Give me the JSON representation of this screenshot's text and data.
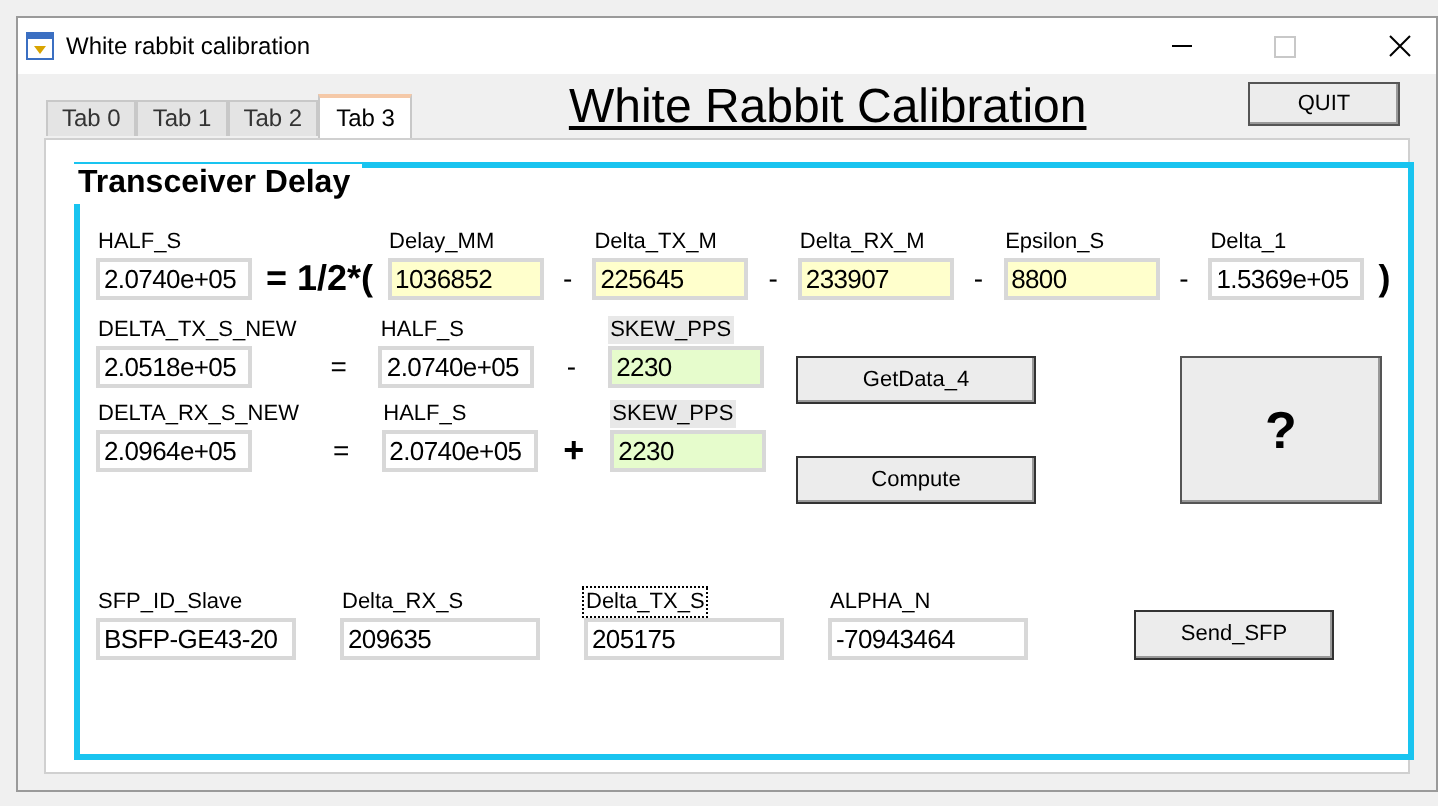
{
  "window": {
    "title": "White rabbit calibration"
  },
  "tabs": [
    {
      "label": "Tab 0",
      "selected": false
    },
    {
      "label": "Tab 1",
      "selected": false
    },
    {
      "label": "Tab 2",
      "selected": false
    },
    {
      "label": "Tab 3",
      "selected": true
    }
  ],
  "heading": "White Rabbit Calibration",
  "quit_button": "QUIT",
  "group": {
    "title": "Transceiver Delay",
    "formula_row": [
      {
        "kind": "field",
        "label": "HALF_S",
        "value": "2.0740e+05",
        "color": "#ffffff"
      },
      {
        "kind": "operator",
        "text": "= 1/2*(",
        "emphasis": true
      },
      {
        "kind": "field",
        "label": "Delay_MM",
        "value": "1036852",
        "color": "#ffffcc"
      },
      {
        "kind": "operator",
        "text": "-",
        "emphasis": false
      },
      {
        "kind": "field",
        "label": "Delta_TX_M",
        "value": "225645",
        "color": "#ffffcc"
      },
      {
        "kind": "operator",
        "text": "-",
        "emphasis": false
      },
      {
        "kind": "field",
        "label": "Delta_RX_M",
        "value": "233907",
        "color": "#ffffcc"
      },
      {
        "kind": "operator",
        "text": "-",
        "emphasis": false
      },
      {
        "kind": "field",
        "label": "Epsilon_S",
        "value": "8800",
        "color": "#ffffcc"
      },
      {
        "kind": "operator",
        "text": "-",
        "emphasis": false
      },
      {
        "kind": "field",
        "label": "Delta_1",
        "value": "1.5369e+05",
        "color": "#ffffff"
      },
      {
        "kind": "operator",
        "text": ")",
        "emphasis": true
      }
    ],
    "equation_rows": [
      [
        {
          "kind": "field",
          "label": "DELTA_TX_S_NEW",
          "value": "2.0518e+05",
          "color": "#ffffff"
        },
        {
          "kind": "operator",
          "text": "=",
          "emphasis": false
        },
        {
          "kind": "field",
          "label": "HALF_S",
          "value": "2.0740e+05",
          "color": "#ffffff"
        },
        {
          "kind": "operator",
          "text": "-",
          "emphasis": false
        },
        {
          "kind": "field",
          "label": "SKEW_PPS",
          "value": "2230",
          "color": "#e6fccc",
          "label_shaded": true
        }
      ],
      [
        {
          "kind": "field",
          "label": "DELTA_RX_S_NEW",
          "value": "2.0964e+05",
          "color": "#ffffff"
        },
        {
          "kind": "operator",
          "text": "=",
          "emphasis": false
        },
        {
          "kind": "field",
          "label": "HALF_S",
          "value": "2.0740e+05",
          "color": "#ffffff"
        },
        {
          "kind": "operator",
          "text": "+",
          "emphasis": true
        },
        {
          "kind": "field",
          "label": "SKEW_PPS",
          "value": "2230",
          "color": "#e6fccc",
          "label_shaded": true
        }
      ]
    ],
    "action_buttons": [
      "GetData_4",
      "Compute"
    ],
    "help_button": "?",
    "sfp_fields": [
      {
        "label": "SFP_ID_Slave",
        "value": "BSFP-GE43-20"
      },
      {
        "label": "Delta_RX_S",
        "value": "209635"
      },
      {
        "label": "Delta_TX_S",
        "value": "205175",
        "focused": true
      },
      {
        "label": "ALPHA_N",
        "value": "-70943464"
      }
    ],
    "send_button": "Send_SFP"
  }
}
